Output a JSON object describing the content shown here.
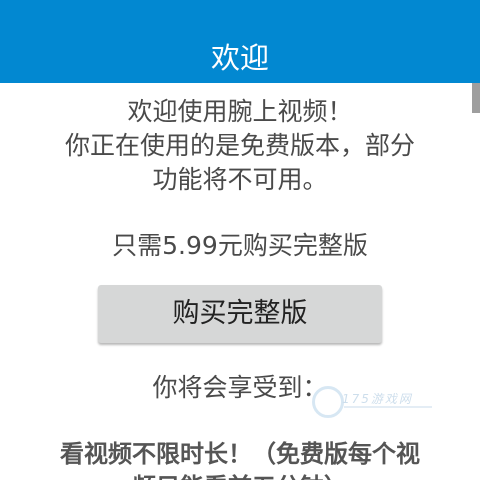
{
  "header": {
    "title": "欢迎"
  },
  "message": {
    "line1": "欢迎使用腕上视频！",
    "line2": "你正在使用的是免费版本，部分",
    "line3": "功能将不可用。",
    "price_text": "只需5.99元购买完整版"
  },
  "buy_button": {
    "label": "购买完整版"
  },
  "benefits": {
    "heading": "你将会享受到：",
    "item1_line1": "看视频不限时长！（免费版每个视",
    "item1_line2": "频只能看前五分钟）"
  },
  "watermark": {
    "text": "175游戏网"
  },
  "colors": {
    "title_bar": "#0288d1",
    "button": "#d6d7d7"
  }
}
